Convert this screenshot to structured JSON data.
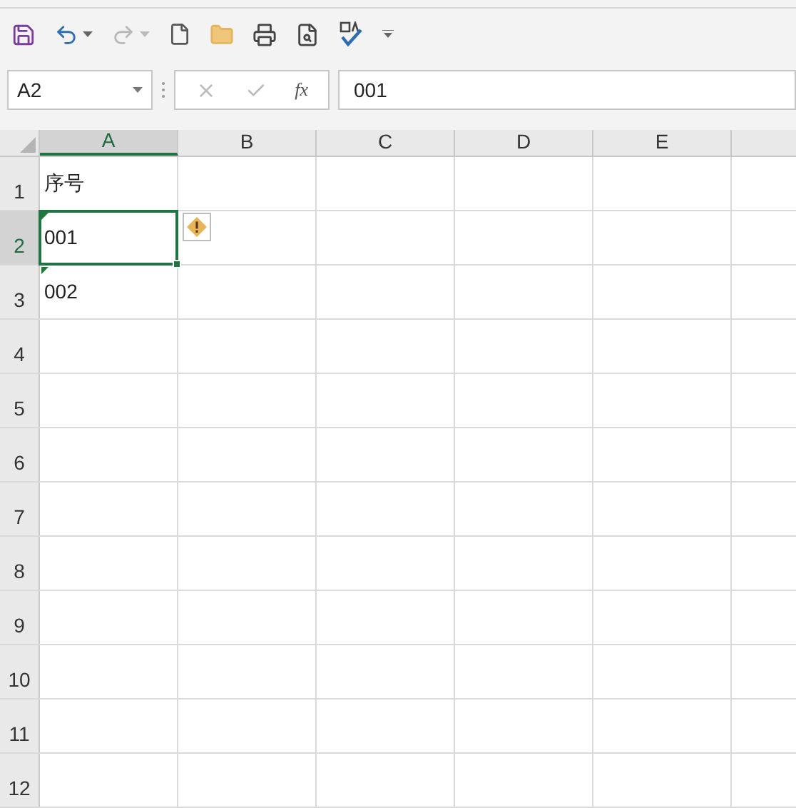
{
  "toolbar": {
    "redo_disabled": true
  },
  "name_box": {
    "value": "A2"
  },
  "formula_bar": {
    "value": "001",
    "fx": "fx"
  },
  "columns": [
    {
      "label": "A",
      "selected": true
    },
    {
      "label": "B",
      "selected": false
    },
    {
      "label": "C",
      "selected": false
    },
    {
      "label": "D",
      "selected": false
    },
    {
      "label": "E",
      "selected": false
    }
  ],
  "rows": [
    {
      "label": "1",
      "selected": false,
      "cells": [
        {
          "text": "序号",
          "selected": false,
          "text_number_flag": false
        }
      ]
    },
    {
      "label": "2",
      "selected": true,
      "cells": [
        {
          "text": "001",
          "selected": true,
          "text_number_flag": true
        }
      ]
    },
    {
      "label": "3",
      "selected": false,
      "cells": [
        {
          "text": "002",
          "selected": false,
          "text_number_flag": true
        }
      ]
    },
    {
      "label": "4",
      "selected": false,
      "cells": []
    },
    {
      "label": "5",
      "selected": false,
      "cells": []
    },
    {
      "label": "6",
      "selected": false,
      "cells": []
    },
    {
      "label": "7",
      "selected": false,
      "cells": []
    },
    {
      "label": "8",
      "selected": false,
      "cells": []
    },
    {
      "label": "9",
      "selected": false,
      "cells": []
    },
    {
      "label": "10",
      "selected": false,
      "cells": []
    },
    {
      "label": "11",
      "selected": false,
      "cells": []
    },
    {
      "label": "12",
      "selected": false,
      "cells": []
    }
  ]
}
